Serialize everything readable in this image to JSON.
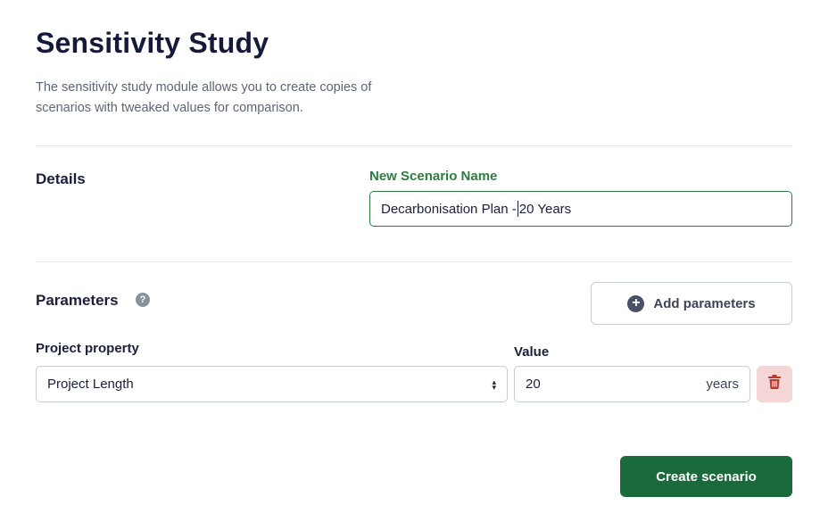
{
  "page": {
    "title": "Sensitivity Study",
    "description": "The sensitivity study module allows you to create copies of scenarios with tweaked values for comparison."
  },
  "details": {
    "section_label": "Details",
    "name_label": "New Scenario Name",
    "name_value_before_caret": "Decarbonisation Plan -",
    "name_value_after_caret": "20 Years"
  },
  "parameters": {
    "section_label": "Parameters",
    "help_icon": "question-circle-icon",
    "add_button_label": "Add parameters",
    "property_label": "Project property",
    "property_value": "Project Length",
    "value_label": "Value",
    "value": "20",
    "unit": "years"
  },
  "actions": {
    "create_label": "Create scenario"
  },
  "colors": {
    "primary": "#1a6a3c",
    "accent_label": "#2e7d40",
    "danger_bg": "#f4d6d6",
    "danger_icon": "#c0392b"
  }
}
